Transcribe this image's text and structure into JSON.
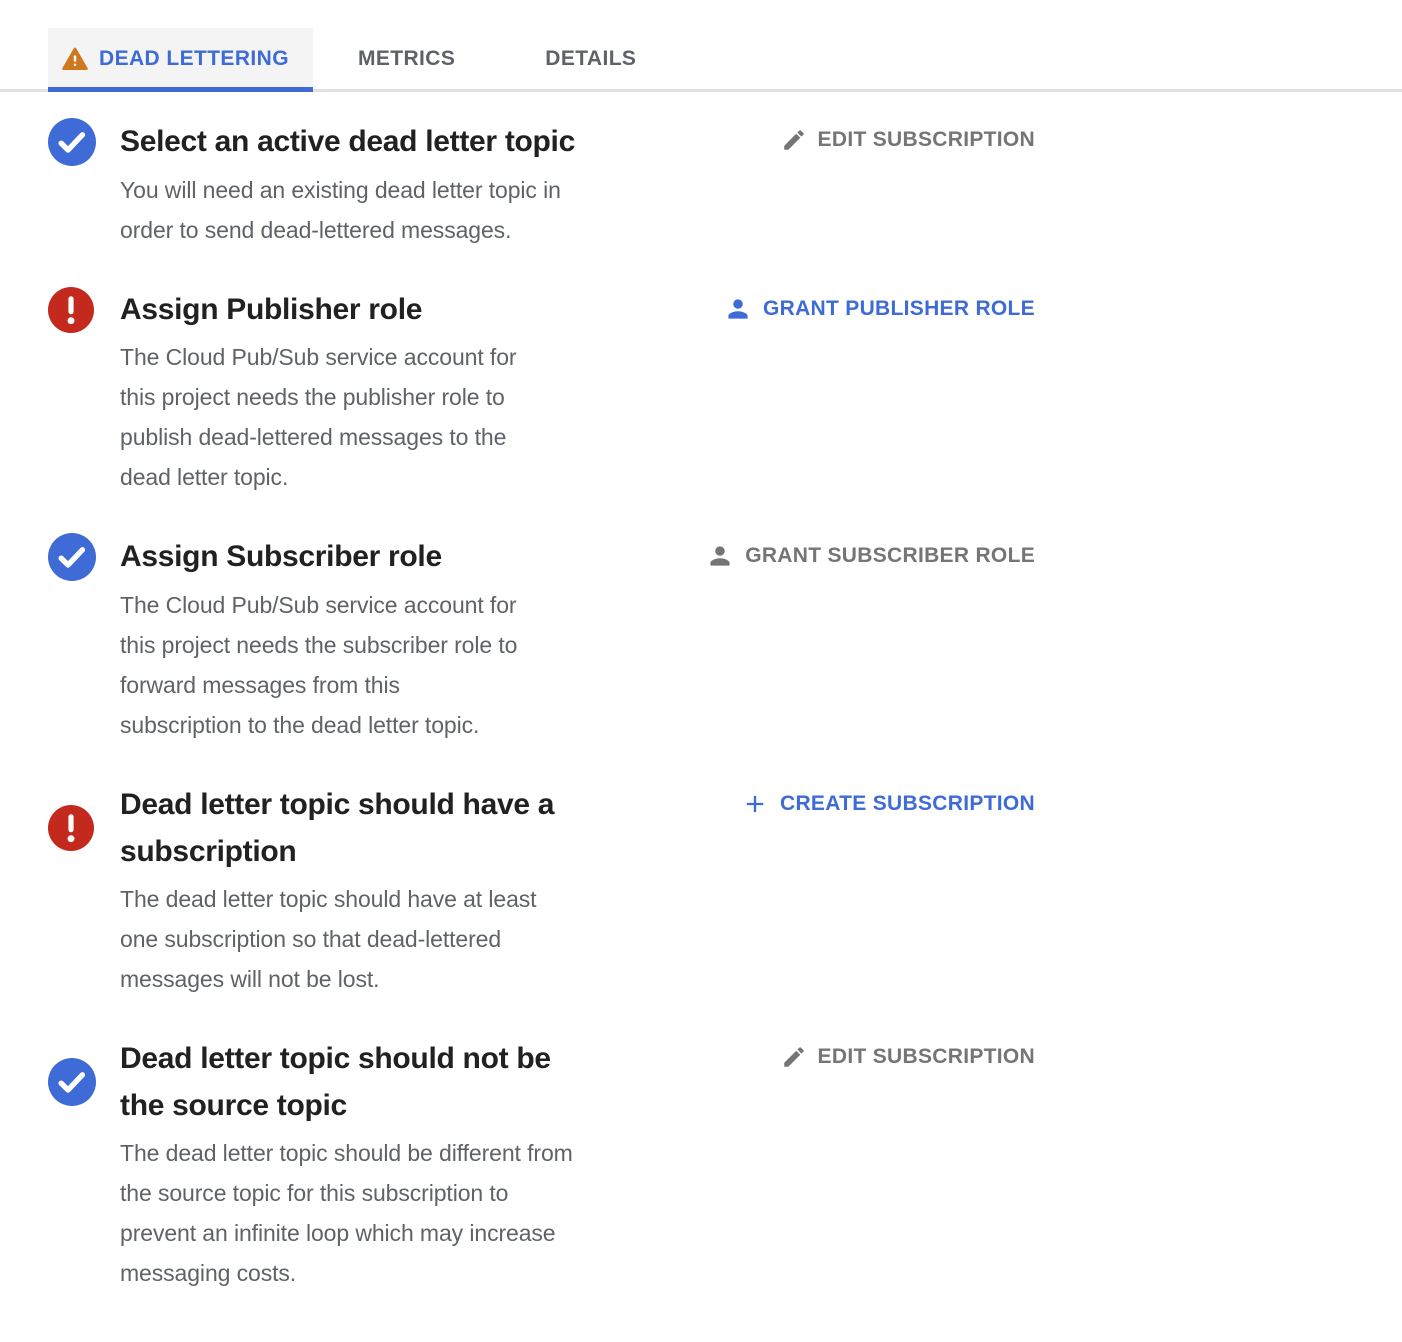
{
  "colors": {
    "accent_blue": "#3e6bd6",
    "error_red": "#c4291d",
    "warning_orange": "#d0781f",
    "title_text": "#212121",
    "description_text": "#5f6368",
    "inactive_action_text": "#757575",
    "active_tab_background": "#f4f4f4"
  },
  "tabs": [
    {
      "label": "DEAD LETTERING",
      "active": true,
      "icon": "warning-triangle-icon"
    },
    {
      "label": "METRICS",
      "active": false
    },
    {
      "label": "DETAILS",
      "active": false
    }
  ],
  "checks": [
    {
      "status": "pass",
      "status_icon": "check-circle-icon",
      "title": "Select an active dead letter topic",
      "description": "You will need an existing dead letter topic in\norder to send dead-lettered messages.",
      "action": {
        "label": "EDIT SUBSCRIPTION",
        "icon": "edit-pencil-icon",
        "style": "gray"
      }
    },
    {
      "status": "fail",
      "status_icon": "error-circle-icon",
      "title": "Assign Publisher role",
      "description": "The Cloud Pub/Sub service account for\nthis project needs the publisher role to\npublish dead-lettered messages to the\ndead letter topic.",
      "action": {
        "label": "GRANT PUBLISHER ROLE",
        "icon": "person-icon",
        "style": "blue"
      }
    },
    {
      "status": "pass",
      "status_icon": "check-circle-icon",
      "title": "Assign Subscriber role",
      "description": "The Cloud Pub/Sub service account for\nthis project needs the subscriber role to\nforward messages from this\nsubscription to the dead letter topic.",
      "action": {
        "label": "GRANT SUBSCRIBER ROLE",
        "icon": "person-icon",
        "style": "gray"
      }
    },
    {
      "status": "fail",
      "status_icon": "error-circle-icon",
      "title": "Dead letter topic should have a\nsubscription",
      "description": "The dead letter topic should have at least\none subscription so that dead-lettered\nmessages will not be lost.",
      "action": {
        "label": "CREATE SUBSCRIPTION",
        "icon": "plus-icon",
        "style": "blue"
      }
    },
    {
      "status": "pass",
      "status_icon": "check-circle-icon",
      "title": "Dead letter topic should not be\nthe source topic",
      "description": "The dead letter topic should be different from\nthe source topic for this subscription to\nprevent an infinite loop which may increase\nmessaging costs.",
      "action": {
        "label": "EDIT SUBSCRIPTION",
        "icon": "edit-pencil-icon",
        "style": "gray"
      }
    }
  ]
}
